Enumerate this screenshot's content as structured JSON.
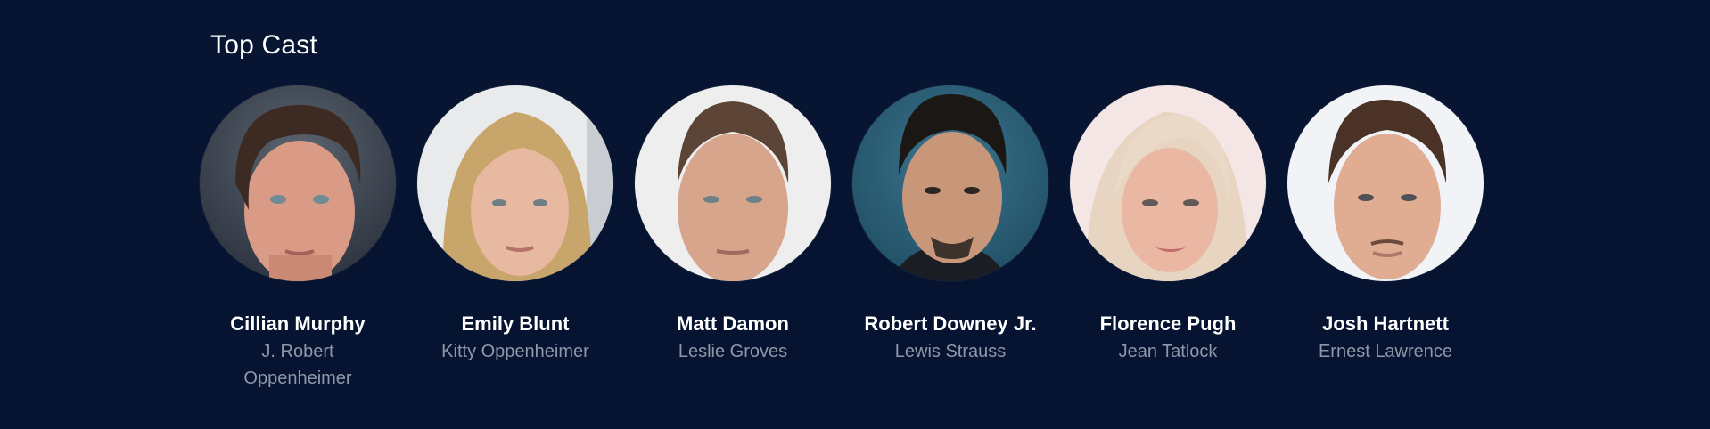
{
  "section": {
    "title": "Top Cast"
  },
  "cast": [
    {
      "name": "Cillian Murphy",
      "character": "J. Robert Oppenheimer",
      "photo": "actor-portrait"
    },
    {
      "name": "Emily Blunt",
      "character": "Kitty Oppenheimer",
      "photo": "actor-portrait"
    },
    {
      "name": "Matt Damon",
      "character": "Leslie Groves",
      "photo": "actor-portrait"
    },
    {
      "name": "Robert Downey Jr.",
      "character": "Lewis Strauss",
      "photo": "actor-portrait"
    },
    {
      "name": "Florence Pugh",
      "character": "Jean Tatlock",
      "photo": "actor-portrait"
    },
    {
      "name": "Josh Hartnett",
      "character": "Ernest Lawrence",
      "photo": "actor-portrait"
    }
  ],
  "colors": {
    "background": "#061431",
    "name_text": "#ffffff",
    "character_text": "#8f97a8"
  }
}
